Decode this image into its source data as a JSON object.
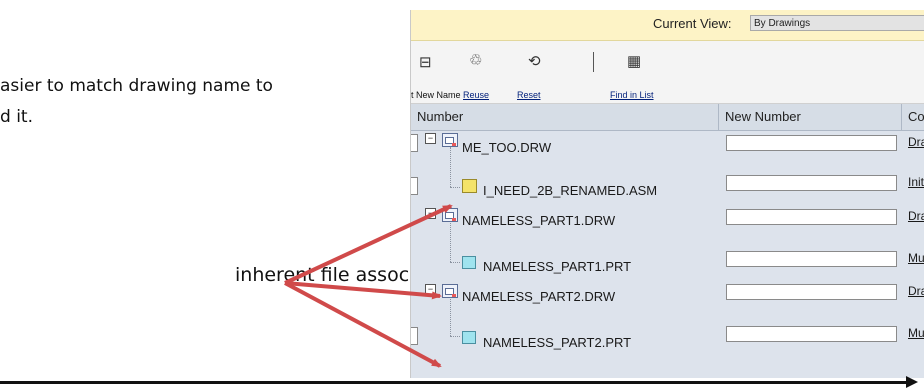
{
  "captions": {
    "line1": "asier to match drawing name to",
    "line2": "d it."
  },
  "annotation": "inherent file association",
  "current_view": {
    "label": "Current View:",
    "value": "By Drawings"
  },
  "toolbar": {
    "new_name": "t New Name",
    "reuse": "Reuse",
    "reset": "Reset",
    "find_in_list": "Find in List"
  },
  "columns": {
    "number": "Number",
    "new_number": "New Number",
    "comment": "Co"
  },
  "rows": [
    {
      "name": "ME_TOO.DRW",
      "type": "drw",
      "comment": "Dra"
    },
    {
      "name": "I_NEED_2B_RENAMED.ASM",
      "type": "asm",
      "comment": "Init"
    },
    {
      "name": "NAMELESS_PART1.DRW",
      "type": "drw",
      "comment": "Dra"
    },
    {
      "name": "NAMELESS_PART1.PRT",
      "type": "prt",
      "comment": "Mu"
    },
    {
      "name": "NAMELESS_PART2.DRW",
      "type": "drw",
      "comment": "Dra"
    },
    {
      "name": "NAMELESS_PART2.PRT",
      "type": "prt",
      "comment": "Mu"
    }
  ],
  "colors": {
    "arrow": "#d04a4a",
    "viewbar": "#fdf3c6",
    "grid": "#dde3ec"
  }
}
